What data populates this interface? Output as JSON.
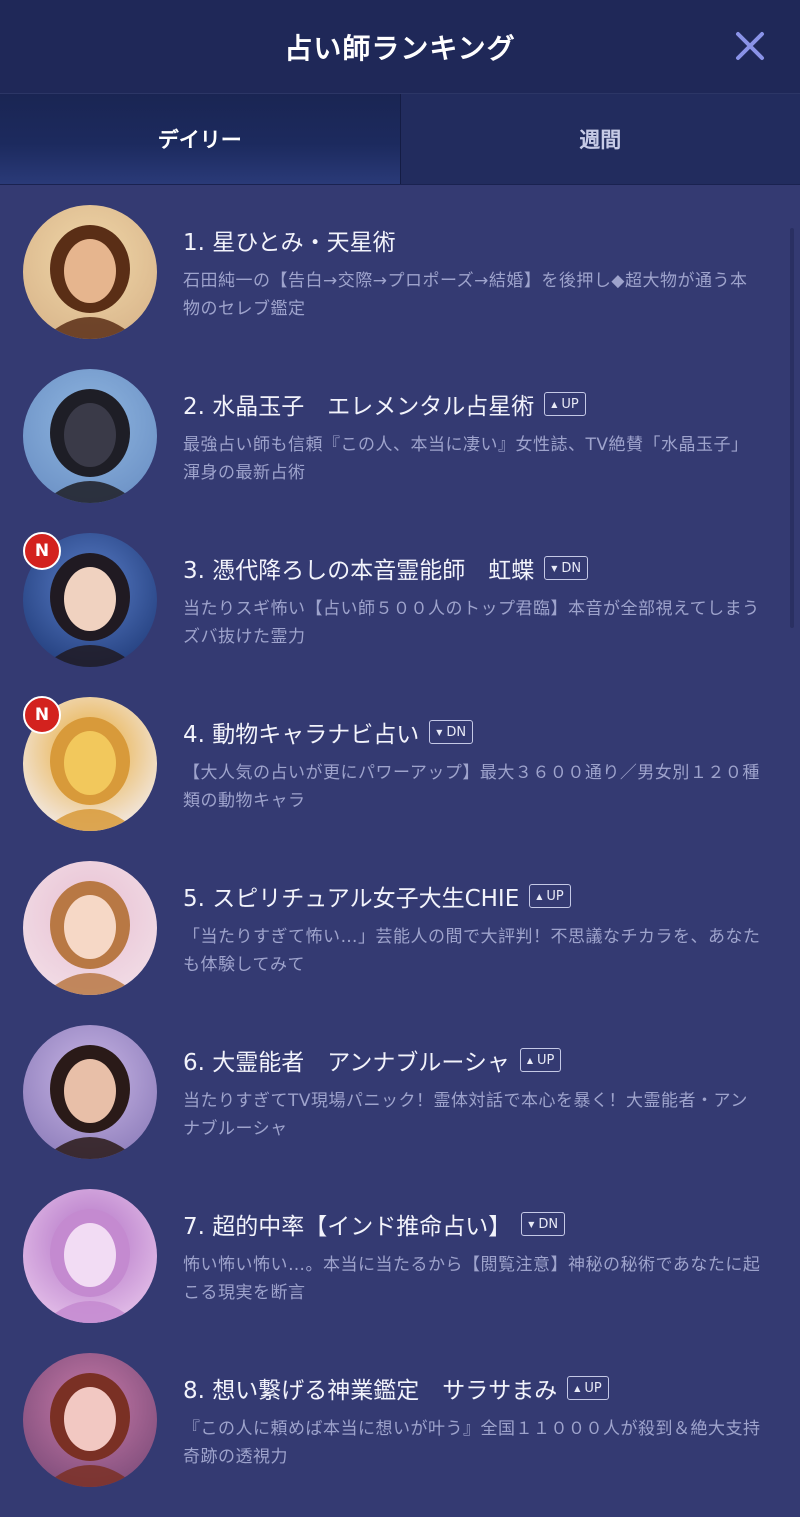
{
  "header": {
    "title": "占い師ランキング"
  },
  "tabs": [
    {
      "label": "デイリー",
      "active": true
    },
    {
      "label": "週間",
      "active": false
    }
  ],
  "items": [
    {
      "title": "1. 星ひとみ・天星術",
      "badge": null,
      "is_new": false,
      "desc": "石田純一の【告白→交際→プロポーズ→結婚】を後押し◆超大物が通う本物のセレブ鑑定"
    },
    {
      "title": "2. 水晶玉子　エレメンタル占星術",
      "badge": "UP",
      "is_new": false,
      "desc": "最強占い師も信頼『この人、本当に凄い』女性誌、TV絶賛「水晶玉子」渾身の最新占術"
    },
    {
      "title": "3. 憑代降ろしの本音霊能師　虹蝶",
      "badge": "DN",
      "is_new": true,
      "desc": "当たりスギ怖い【占い師５００人のトップ君臨】本音が全部視えてしまうズバ抜けた霊力"
    },
    {
      "title": "4. 動物キャラナビ占い",
      "badge": "DN",
      "is_new": true,
      "desc": "【大人気の占いが更にパワーアップ】最大３６００通り／男女別１２０種類の動物キャラ"
    },
    {
      "title": "5. スピリチュアル女子大生CHIE",
      "badge": "UP",
      "is_new": false,
      "desc": "「当たりすぎて怖い…」芸能人の間で大評判！不思議なチカラを、あなたも体験してみて"
    },
    {
      "title": "6. 大霊能者　アンナブルーシャ",
      "badge": "UP",
      "is_new": false,
      "desc": "当たりすぎてTV現場パニック！霊体対話で本心を暴く！大霊能者・アンナブルーシャ"
    },
    {
      "title": "7. 超的中率【インド推命占い】",
      "badge": "DN",
      "is_new": false,
      "desc": "怖い怖い怖い…。本当に当たるから【閲覧注意】神秘の秘術であなたに起こる現実を断言"
    },
    {
      "title": "8. 想い繋げる神業鑑定　サラサまみ",
      "badge": "UP",
      "is_new": false,
      "desc": "『この人に頼めば本当に想いが叶う』全国１１０００人が殺到＆絶大支持　奇跡の透視力"
    }
  ],
  "new_badge_label": "N",
  "avatars": [
    {
      "bg": "#d8b48a",
      "hair": "#5a2e16",
      "skin": "#e6b58e",
      "accent": "#f0d7a8"
    },
    {
      "bg": "#6a8fc4",
      "hair": "#1e1e26",
      "skin": "#3a3a48",
      "accent": "#8fb6e0"
    },
    {
      "bg": "#1f3a78",
      "hair": "#201a22",
      "skin": "#f0d2c0",
      "accent": "#5a7ec8"
    },
    {
      "bg": "#f3f0f8",
      "hair": "#d89a3a",
      "skin": "#f2c85c",
      "accent": "#e8a830"
    },
    {
      "bg": "#f2dfe8",
      "hair": "#b87844",
      "skin": "#f6d8c6",
      "accent": "#e8c0d2"
    },
    {
      "bg": "#8a7ab8",
      "hair": "#2a1a18",
      "skin": "#e8bfa8",
      "accent": "#c9b6e6"
    },
    {
      "bg": "#e8c6ec",
      "hair": "#c48ad0",
      "skin": "#f2dcf4",
      "accent": "#b070c4"
    },
    {
      "bg": "#7a4a78",
      "hair": "#7a3024",
      "skin": "#f2c8c2",
      "accent": "#c87aa8"
    }
  ],
  "colors": {
    "header_bg": "#1f2858",
    "list_bg": "#343a72",
    "new_badge": "#d3221e",
    "close_icon": "#8a93e8"
  }
}
